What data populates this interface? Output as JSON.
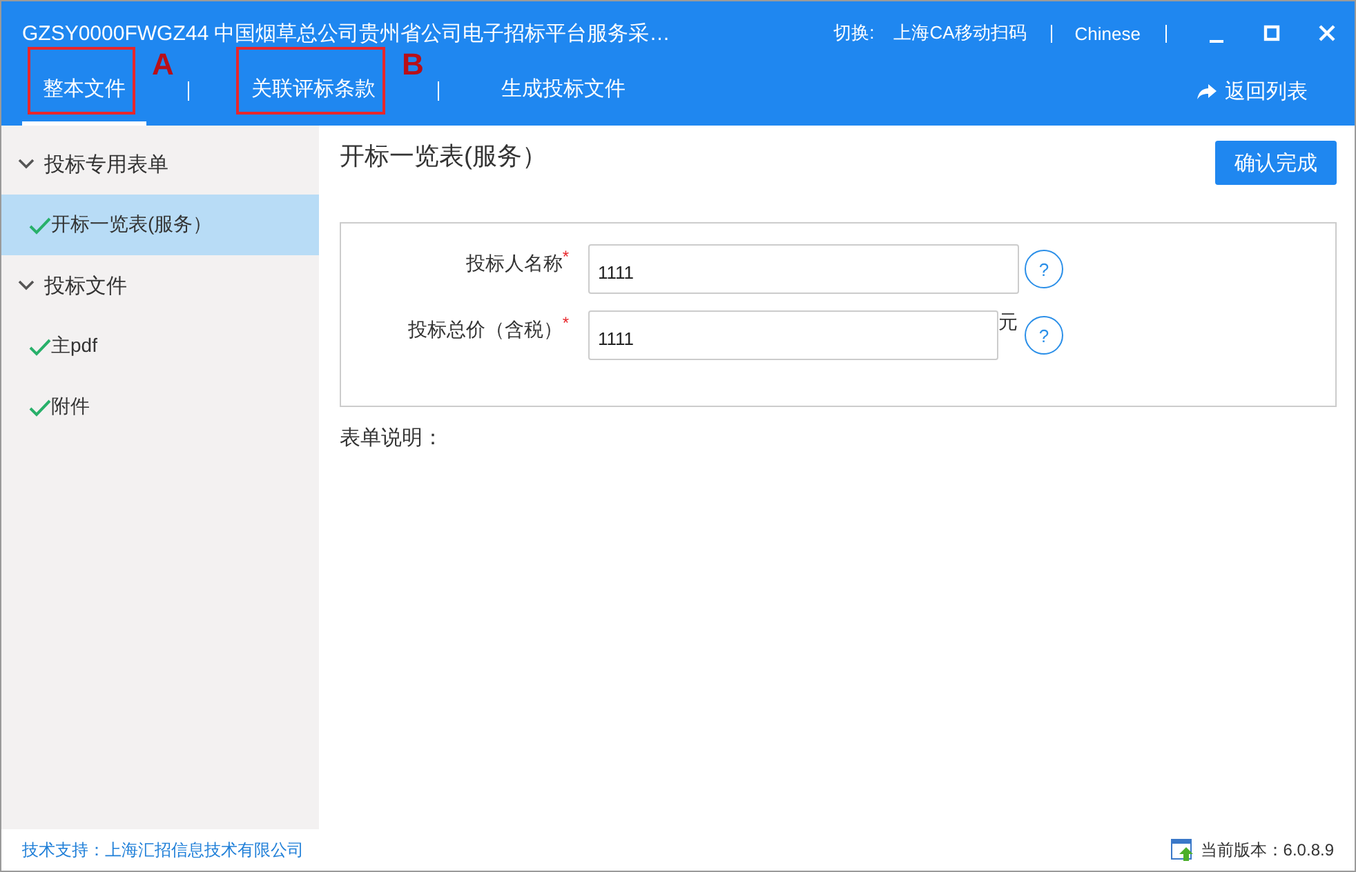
{
  "window": {
    "title": "GZSY0000FWGZ44 中国烟草总公司贵州省公司电子招标平台服务采…",
    "switch_label": "切换:",
    "ca_link": "上海CA移动扫码",
    "language": "Chinese",
    "controls": [
      {
        "kind": "minimize"
      },
      {
        "kind": "maximize"
      },
      {
        "kind": "close"
      }
    ]
  },
  "tabs": [
    {
      "label": "整本文件",
      "selected": true,
      "annotation": "A"
    },
    {
      "label": "关联评标条款",
      "selected": false,
      "annotation": "B"
    },
    {
      "label": "生成投标文件",
      "selected": false
    }
  ],
  "back_button": {
    "label": "返回列表"
  },
  "sidebar": {
    "groups": [
      {
        "label": "投标专用表单",
        "expanded": true,
        "children": [
          {
            "label": "开标一览表(服务）",
            "done": true,
            "selected": true
          }
        ]
      },
      {
        "label": "投标文件",
        "expanded": true,
        "children": [
          {
            "label": "主pdf",
            "done": true,
            "selected": false
          },
          {
            "label": "附件",
            "done": true,
            "selected": false
          }
        ]
      }
    ]
  },
  "main": {
    "title": "开标一览表(服务）",
    "confirm_button": "确认完成",
    "fields": [
      {
        "label": "投标人名称",
        "required_mark": "*",
        "value": "1111",
        "help": "?"
      },
      {
        "label": "投标总价（含税）",
        "required_mark": "*",
        "value": "1111",
        "unit": "元",
        "help": "?"
      }
    ],
    "note": "表单说明："
  },
  "status_bar": {
    "support": "技术支持：上海汇招信息技术有限公司",
    "version": "当前版本：6.0.8.9"
  }
}
